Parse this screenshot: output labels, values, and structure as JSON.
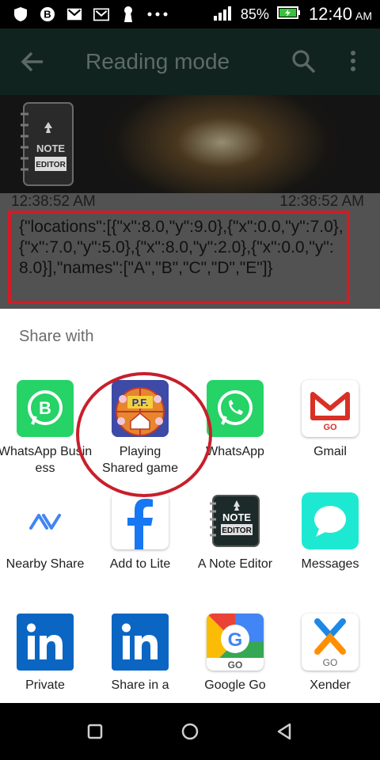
{
  "status_bar": {
    "battery": "85%",
    "time": "12:40",
    "ampm": "AM",
    "icons": [
      "shield-icon",
      "b-logo-icon",
      "gmail-icon",
      "gmail-icon",
      "keyhole-icon",
      "more-dots-icon",
      "signal-icon",
      "battery-icon"
    ]
  },
  "app_bar": {
    "title": "Reading mode",
    "icons": [
      "back-arrow-icon",
      "search-icon",
      "more-vert-icon"
    ]
  },
  "banner": {
    "logo_line1": "NOTE",
    "logo_line2": "EDITOR"
  },
  "note": {
    "timestamp_left": "12:38:52 AM",
    "timestamp_right": "12:38:52 AM",
    "text": "{\"locations\":[{\"x\":8.0,\"y\":9.0},{\"x\":0.0,\"y\":7.0},{\"x\":7.0,\"y\":5.0},{\"x\":8.0,\"y\":2.0},{\"x\":0.0,\"y\":8.0}],\"names\":[\"A\",\"B\",\"C\",\"D\",\"E\"]}"
  },
  "share_sheet": {
    "header": "Share with",
    "apps": [
      {
        "label": "WhatsApp Business",
        "icon": "whatsapp-business-icon"
      },
      {
        "label": "Playing\nShared game",
        "icon": "playing-shared-game-icon",
        "icon_text": "P.F."
      },
      {
        "label": "WhatsApp",
        "icon": "whatsapp-icon"
      },
      {
        "label": "Gmail",
        "icon": "gmail-icon",
        "icon_text": "GO"
      },
      {
        "label": "Nearby Share",
        "icon": "nearby-share-icon"
      },
      {
        "label": "Add to Lite",
        "icon": "facebook-icon"
      },
      {
        "label": "A Note Editor",
        "icon": "note-editor-icon",
        "icon_text": "NOTE\nEDITOR"
      },
      {
        "label": "Messages",
        "icon": "messages-icon"
      },
      {
        "label": "Private",
        "icon": "linkedin-icon"
      },
      {
        "label": "Share in a",
        "icon": "linkedin-icon"
      },
      {
        "label": "Google Go",
        "icon": "google-go-icon",
        "icon_text": "GO"
      },
      {
        "label": "Xender",
        "icon": "xender-icon",
        "icon_text": "GO"
      }
    ]
  },
  "nav_bar": {
    "icons": [
      "recents-square-icon",
      "home-circle-icon",
      "back-triangle-icon"
    ]
  },
  "colors": {
    "highlight_red": "#d21c25",
    "whatsapp_green": "#25d366",
    "linkedin_blue": "#0a66c2",
    "facebook_blue": "#1877f2"
  }
}
